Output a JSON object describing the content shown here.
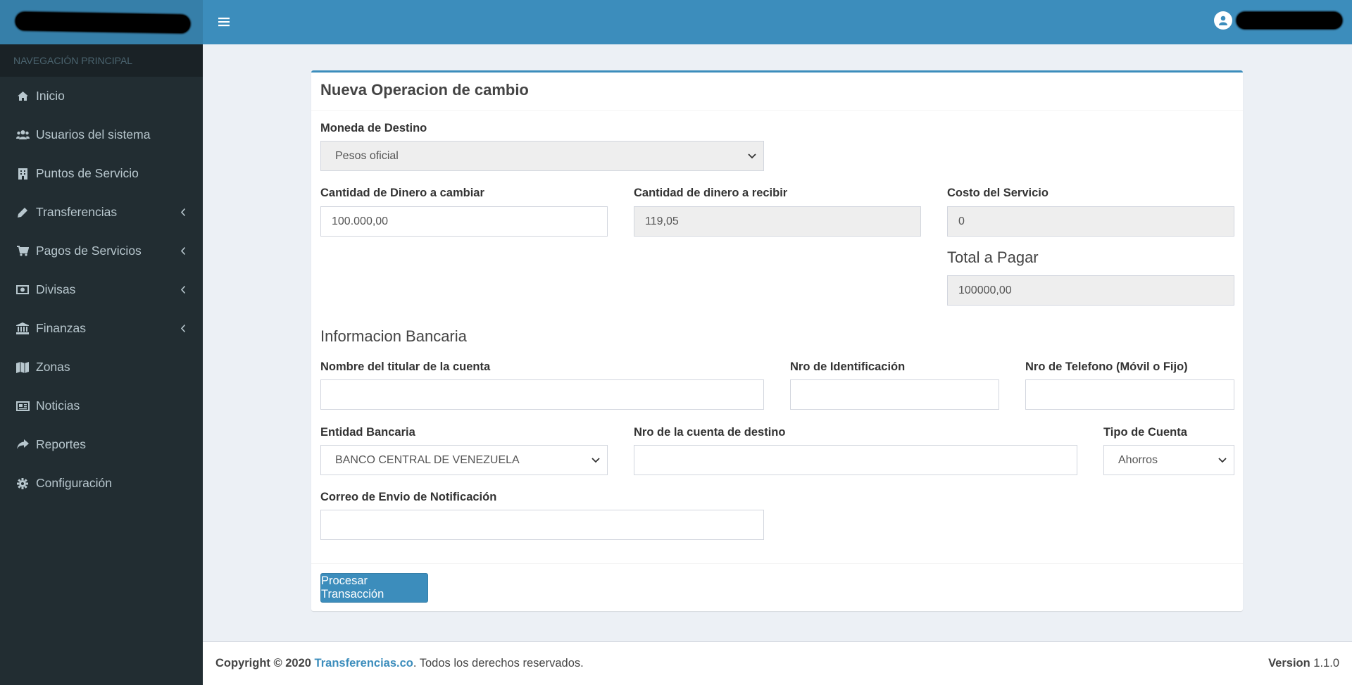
{
  "sidebar": {
    "nav_header": "NAVEGACIÓN PRINCIPAL",
    "items": [
      {
        "label": "Inicio",
        "icon": "home-icon"
      },
      {
        "label": "Usuarios del sistema",
        "icon": "users-icon"
      },
      {
        "label": "Puntos de Servicio",
        "icon": "building-icon"
      },
      {
        "label": "Transferencias",
        "icon": "pencil-icon",
        "has_submenu": true
      },
      {
        "label": "Pagos de Servicios",
        "icon": "cart-icon",
        "has_submenu": true
      },
      {
        "label": "Divisas",
        "icon": "money-icon",
        "has_submenu": true
      },
      {
        "label": "Finanzas",
        "icon": "bank-icon",
        "has_submenu": true
      },
      {
        "label": "Zonas",
        "icon": "map-icon"
      },
      {
        "label": "Noticias",
        "icon": "newspaper-icon"
      },
      {
        "label": "Reportes",
        "icon": "share-icon"
      },
      {
        "label": "Configuración",
        "icon": "gear-icon"
      }
    ]
  },
  "form": {
    "title": "Nueva Operacion de cambio",
    "moneda_destino": {
      "label": "Moneda de Destino",
      "value": "Pesos oficial"
    },
    "cantidad_cambiar": {
      "label": "Cantidad de Dinero a cambiar",
      "value": "100.000,00"
    },
    "cantidad_recibir": {
      "label": "Cantidad de dinero a recibir",
      "value": "119,05"
    },
    "costo_servicio": {
      "label": "Costo del Servicio",
      "value": "0"
    },
    "total_pagar": {
      "label": "Total a Pagar",
      "value": "100000,00"
    },
    "bank_section_title": "Informacion Bancaria",
    "titular": {
      "label": "Nombre del titular de la cuenta",
      "value": ""
    },
    "identificacion": {
      "label": "Nro de Identificación",
      "value": ""
    },
    "telefono": {
      "label": "Nro de Telefono (Móvil o Fijo)",
      "value": ""
    },
    "entidad": {
      "label": "Entidad Bancaria",
      "value": "BANCO CENTRAL DE VENEZUELA"
    },
    "cuenta_destino": {
      "label": "Nro de la cuenta de destino",
      "value": ""
    },
    "tipo_cuenta": {
      "label": "Tipo de Cuenta",
      "value": "Ahorros"
    },
    "correo": {
      "label": "Correo de Envio de Notificación",
      "value": ""
    },
    "submit_label": "Procesar Transacción"
  },
  "footer": {
    "copyright_prefix": "Copyright © 2020",
    "company": "Transferencias.co",
    "rights": ". Todos los derechos reservados.",
    "version_label": "Version",
    "version": "1.1.0"
  },
  "colors": {
    "brand": "#3c8dbc",
    "sidebar_bg": "#222d32",
    "content_bg": "#ecf0f5"
  }
}
